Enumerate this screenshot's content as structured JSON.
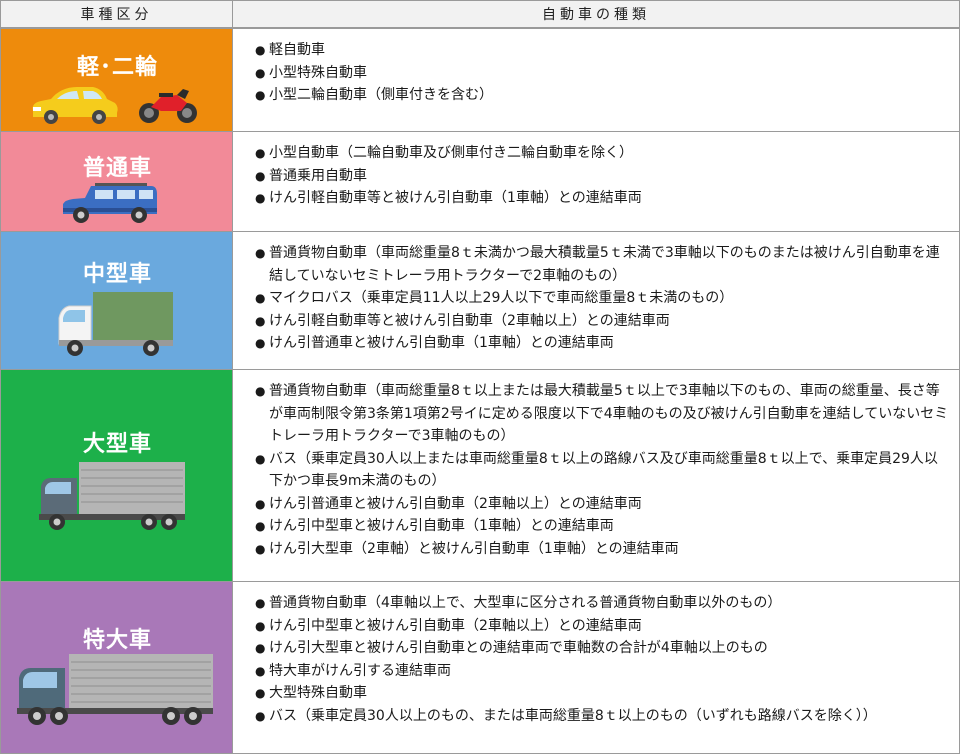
{
  "header": {
    "left": "車種区分",
    "right": "自動車の種類"
  },
  "rows": [
    {
      "label": "軽･二輪",
      "color": "#ee8b0c",
      "icons": [
        "yellow-car-icon",
        "motorcycle-icon"
      ],
      "items": [
        "軽自動車",
        "小型特殊自動車",
        "小型二輪自動車（側車付きを含む）"
      ]
    },
    {
      "label": "普通車",
      "color": "#f28a98",
      "icons": [
        "blue-suv-icon"
      ],
      "items": [
        "小型自動車（二輪自動車及び側車付き二輪自動車を除く）",
        "普通乗用自動車",
        "けん引軽自動車等と被けん引自動車（1車軸）との連結車両"
      ]
    },
    {
      "label": "中型車",
      "color": "#6aa9de",
      "icons": [
        "small-truck-icon"
      ],
      "items": [
        "普通貨物自動車（車両総重量8ｔ未満かつ最大積載量5ｔ未満で3車軸以下のものまたは被けん引自動車を連結していないセミトレーラ用トラクターで2車軸のもの）",
        "マイクロバス（乗車定員11人以上29人以下で車両総重量8ｔ未満のもの）",
        "けん引軽自動車等と被けん引自動車（2車軸以上）との連結車両",
        "けん引普通車と被けん引自動車（1車軸）との連結車両"
      ]
    },
    {
      "label": "大型車",
      "color": "#1db04a",
      "icons": [
        "gray-truck-icon"
      ],
      "items": [
        "普通貨物自動車（車両総重量8ｔ以上または最大積載量5ｔ以上で3車軸以下のもの、車両の総重量、長さ等が車両制限令第3条第1項第2号イに定める限度以下で4車軸のもの及び被けん引自動車を連結していないセミトレーラ用トラクターで3車軸のもの）",
        "バス（乗車定員30人以上または車両総重量8ｔ以上の路線バス及び車両総重量8ｔ以上で、乗車定員29人以下かつ車長9m未満のもの）",
        "けん引普通車と被けん引自動車（2車軸以上）との連結車両",
        "けん引中型車と被けん引自動車（1車軸）との連結車両",
        "けん引大型車（2車軸）と被けん引自動車（1車軸）との連結車両"
      ]
    },
    {
      "label": "特大車",
      "color": "#a978b8",
      "icons": [
        "large-truck-icon"
      ],
      "items": [
        "普通貨物自動車（4車軸以上で、大型車に区分される普通貨物自動車以外のもの）",
        "けん引中型車と被けん引自動車（2車軸以上）との連結車両",
        "けん引大型車と被けん引自動車との連結車両で車軸数の合計が4車軸以上のもの",
        "特大車がけん引する連結車両",
        "大型特殊自動車",
        "バス（乗車定員30人以上のもの、または車両総重量8ｔ以上のもの（いずれも路線バスを除く））"
      ]
    }
  ]
}
